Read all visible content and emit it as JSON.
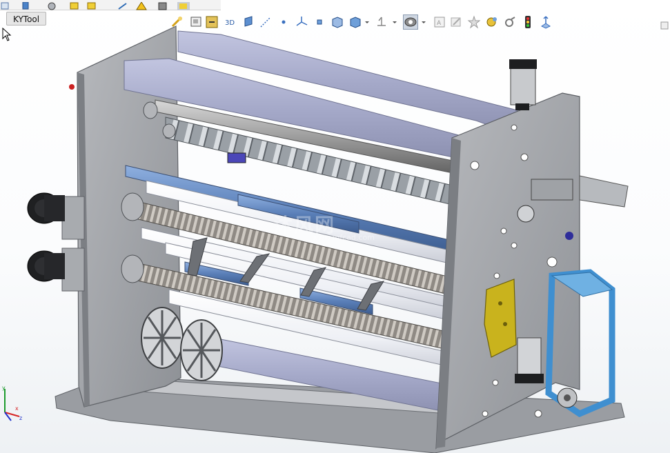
{
  "toolbar_tab": {
    "label": "KYTool"
  },
  "watermark": {
    "text": "沐风网",
    "url": "www.mfcad.com"
  },
  "triad_labels": {
    "x": "x",
    "y": "y",
    "z": "z"
  },
  "heads_up_toolbar": [
    {
      "icon": "zoom-to-fit-icon"
    },
    {
      "icon": "zoom-to-area-icon"
    },
    {
      "icon": "previous-view-icon"
    },
    {
      "icon": "3d-drawing-view-icon"
    },
    {
      "icon": "section-view-icon"
    },
    {
      "icon": "sketch-line-icon"
    },
    {
      "icon": "point-icon"
    },
    {
      "icon": "axis-triad-icon"
    },
    {
      "icon": "origin-icon"
    },
    {
      "icon": "view-orientation-icon"
    },
    {
      "icon": "display-style-icon"
    },
    {
      "icon": "hide-show-items-icon"
    },
    {
      "icon": "edit-appearance-icon"
    },
    {
      "icon": "apply-scene-icon"
    },
    {
      "icon": "view-settings-icon"
    },
    {
      "icon": "render-tools-icon"
    },
    {
      "icon": "cosmetic-thread-icon"
    },
    {
      "icon": "traffic-light-icon"
    },
    {
      "icon": "move-triad-icon"
    }
  ],
  "colors": {
    "frame_gray": "#9b9ea3",
    "roller_blue": "#5a7fb8",
    "roller_white": "#f4f6fa",
    "lavender_bar": "#a7abcc",
    "bracket_yellow": "#c8b21a",
    "guard_blue": "#3f8fd0",
    "motor_black": "#1c1c1e"
  }
}
